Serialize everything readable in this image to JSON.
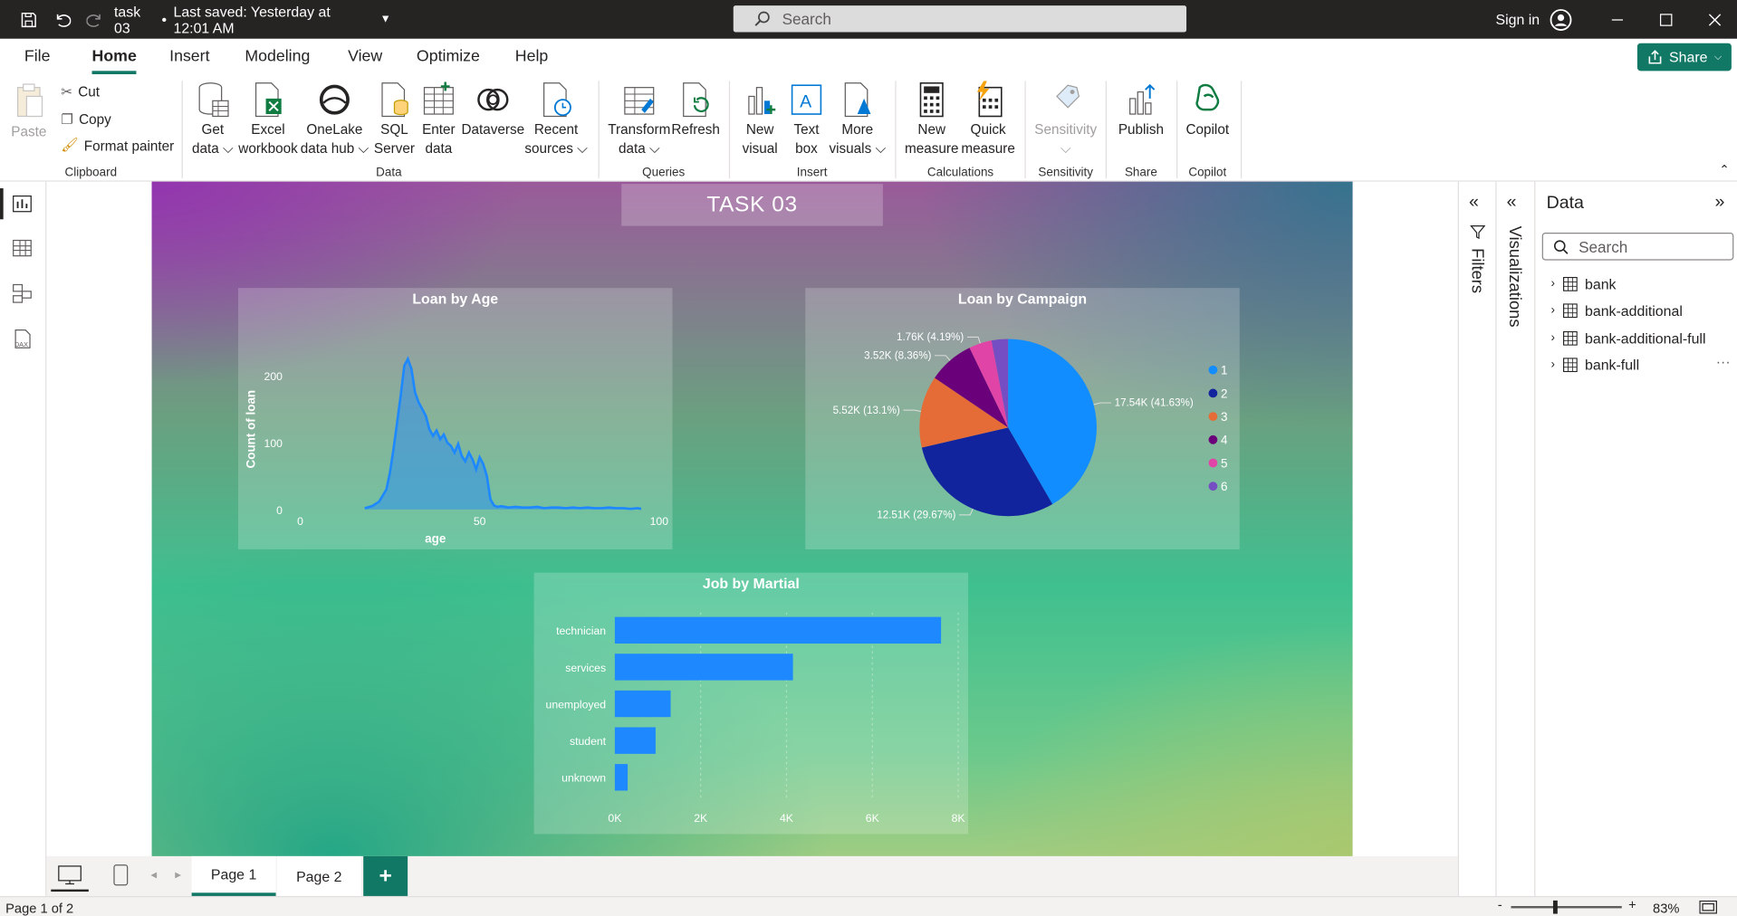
{
  "titlebar": {
    "doc_title": "task 03",
    "saved_status": "Last saved: Yesterday at 12:01 AM",
    "search_placeholder": "Search",
    "sign_in": "Sign in"
  },
  "menu": {
    "tabs": [
      "File",
      "Home",
      "Insert",
      "Modeling",
      "View",
      "Optimize",
      "Help"
    ],
    "share": "Share"
  },
  "ribbon": {
    "paste": "Paste",
    "cut": "Cut",
    "copy": "Copy",
    "format_painter": "Format painter",
    "get_data": [
      "Get",
      "data"
    ],
    "excel": [
      "Excel",
      "workbook"
    ],
    "onelake": [
      "OneLake",
      "data hub"
    ],
    "sql": [
      "SQL",
      "Server"
    ],
    "enter": [
      "Enter",
      "data"
    ],
    "dataverse": "Dataverse",
    "recent": [
      "Recent",
      "sources"
    ],
    "transform": [
      "Transform",
      "data"
    ],
    "refresh": "Refresh",
    "new_visual": [
      "New",
      "visual"
    ],
    "text_box": [
      "Text",
      "box"
    ],
    "more_visuals": [
      "More",
      "visuals"
    ],
    "new_measure": [
      "New",
      "measure"
    ],
    "quick_measure": [
      "Quick",
      "measure"
    ],
    "sensitivity": "Sensitivity",
    "publish": "Publish",
    "copilot": "Copilot",
    "groups": {
      "clipboard": "Clipboard",
      "data": "Data",
      "queries": "Queries",
      "insert": "Insert",
      "calculations": "Calculations",
      "sensitivity": "Sensitivity",
      "share": "Share",
      "copilot": "Copilot"
    }
  },
  "report": {
    "title": "TASK 03"
  },
  "chart_data": [
    {
      "type": "area",
      "title": "Loan by Age",
      "xlabel": "age",
      "ylabel": "Count of loan",
      "xlim": [
        0,
        100
      ],
      "ylim": [
        0,
        240
      ],
      "x_ticks": [
        0,
        50,
        100
      ],
      "y_ticks": [
        0,
        100,
        200
      ],
      "x": [
        18,
        20,
        22,
        24,
        25,
        26,
        27,
        28,
        29,
        30,
        31,
        32,
        33,
        34,
        35,
        36,
        37,
        38,
        39,
        40,
        41,
        42,
        43,
        44,
        45,
        46,
        47,
        48,
        49,
        50,
        51,
        52,
        53,
        54,
        55,
        56,
        57,
        58,
        60,
        62,
        64,
        66,
        68,
        70,
        72,
        74,
        76,
        78,
        80,
        82,
        84,
        86,
        88,
        90,
        92,
        94,
        95
      ],
      "y": [
        2,
        5,
        12,
        30,
        55,
        90,
        130,
        170,
        215,
        225,
        210,
        175,
        160,
        150,
        140,
        120,
        110,
        118,
        105,
        112,
        100,
        95,
        85,
        98,
        80,
        72,
        85,
        75,
        60,
        78,
        68,
        50,
        15,
        6,
        4,
        5,
        4,
        3,
        4,
        3,
        3,
        4,
        2,
        3,
        3,
        2,
        3,
        2,
        3,
        2,
        2,
        3,
        2,
        2,
        1,
        2,
        1
      ],
      "color": "#1e88ff"
    },
    {
      "type": "pie",
      "title": "Loan by Campaign",
      "slices": [
        {
          "name": "1",
          "value": 17540,
          "label": "17.54K (41.63%)",
          "color": "#118dff"
        },
        {
          "name": "2",
          "value": 12510,
          "label": "12.51K (29.67%)",
          "color": "#12239e"
        },
        {
          "name": "3",
          "value": 5520,
          "label": "5.52K (13.1%)",
          "color": "#e66c37"
        },
        {
          "name": "4",
          "value": 3520,
          "label": "3.52K (8.36%)",
          "color": "#6b007b"
        },
        {
          "name": "5",
          "value": 1760,
          "label": "1.76K (4.19%)",
          "color": "#e044a7"
        },
        {
          "name": "6",
          "value": 1260,
          "label": "",
          "color": "#744ec2"
        }
      ],
      "legend_position": "right"
    },
    {
      "type": "bar",
      "orientation": "horizontal",
      "title": "Job by Martial",
      "categories": [
        "technician",
        "services",
        "unemployed",
        "student",
        "unknown"
      ],
      "values": [
        7600,
        4150,
        1300,
        950,
        300
      ],
      "xlim": [
        0,
        8000
      ],
      "x_ticks": [
        "0K",
        "2K",
        "4K",
        "6K",
        "8K"
      ],
      "color": "#1e88ff"
    }
  ],
  "filters_label": "Filters",
  "visualizations_label": "Visualizations",
  "data_pane": {
    "title": "Data",
    "search_placeholder": "Search",
    "tables": [
      "bank",
      "bank-additional",
      "bank-additional-full",
      "bank-full"
    ]
  },
  "pages": {
    "tabs": [
      "Page 1",
      "Page 2"
    ],
    "add": "+"
  },
  "status": {
    "page_info": "Page 1 of 2",
    "zoom": "83%"
  }
}
